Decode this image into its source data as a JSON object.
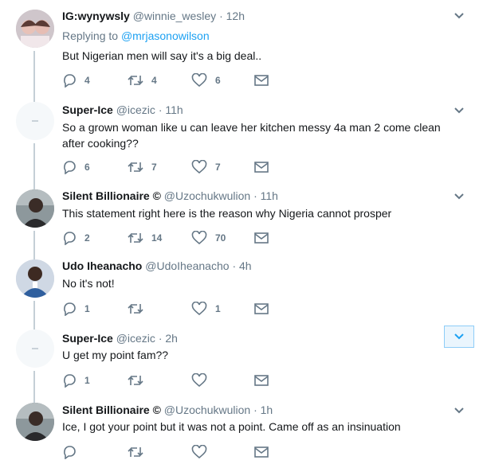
{
  "tweets": [
    {
      "name": "IG:wynywsly",
      "handle": "@winnie_wesley",
      "sep": "·",
      "time": "12h",
      "replying_prefix": "Replying to",
      "replying_to": "@mrjasonowilson",
      "text": "But Nigerian men will say it's a big deal..",
      "replies": "4",
      "retweets": "4",
      "likes": "6"
    },
    {
      "name": "Super-Ice",
      "handle": "@icezic",
      "sep": "·",
      "time": "11h",
      "text": "So a grown woman like u can leave her kitchen messy 4a man 2 come clean after cooking??",
      "replies": "6",
      "retweets": "7",
      "likes": "7"
    },
    {
      "name": "Silent Billionaire ©",
      "handle": "@Uzochukwulion",
      "sep": "·",
      "time": "11h",
      "text": "This statement right here is the reason why Nigeria cannot prosper",
      "replies": "2",
      "retweets": "14",
      "likes": "70"
    },
    {
      "name": "Udo Iheanacho",
      "handle": "@UdoIheanacho",
      "sep": "·",
      "time": "4h",
      "text": "No it's not!",
      "replies": "1",
      "retweets": "",
      "likes": "1"
    },
    {
      "name": "Super-Ice",
      "handle": "@icezic",
      "sep": "·",
      "time": "2h",
      "text": "U get my point fam??",
      "replies": "1",
      "retweets": "",
      "likes": ""
    },
    {
      "name": "Silent Billionaire ©",
      "handle": "@Uzochukwulion",
      "sep": "·",
      "time": "1h",
      "text": "Ice, I got your point but it was not a point. Came off as an insinuation",
      "replies": "",
      "retweets": "",
      "likes": ""
    }
  ],
  "icons": {
    "reply": "reply-icon",
    "retweet": "retweet-icon",
    "like": "heart-icon",
    "dm": "envelope-icon",
    "more": "chevron-down-icon"
  },
  "colors": {
    "icon": "#657786",
    "link": "#1da1f2",
    "thread_line": "#c4cfd6",
    "divider": "#e6ecf0"
  }
}
